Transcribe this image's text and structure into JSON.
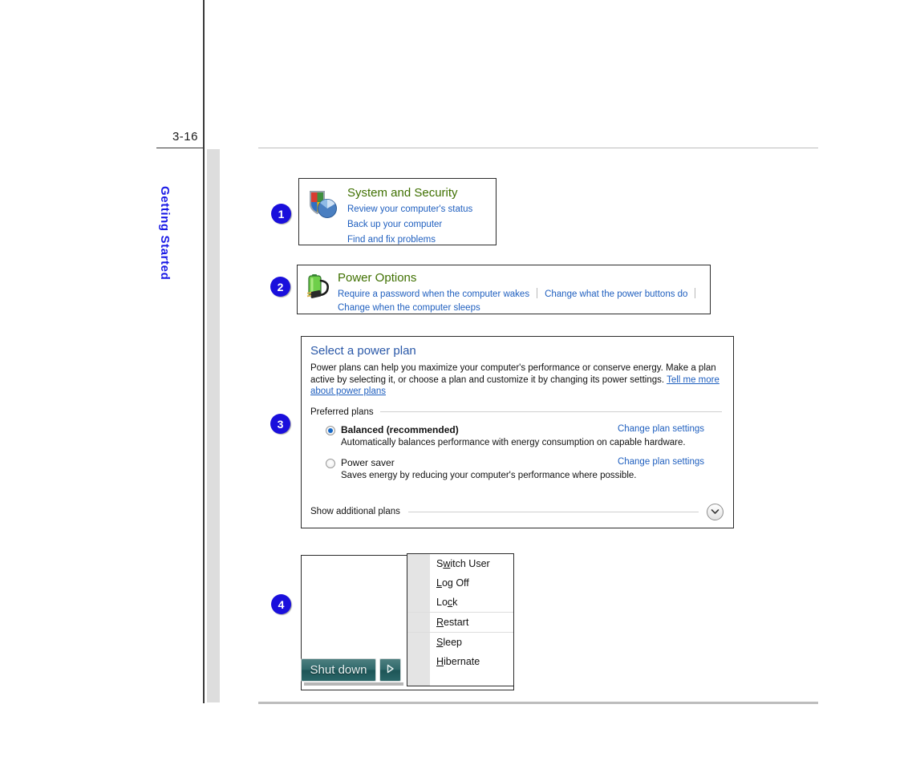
{
  "page": {
    "folio": "3-16",
    "side_tab_label": "Getting Started"
  },
  "colors": {
    "badge_blue": "#1a0fdc",
    "side_tab_blue": "#1a1ae6",
    "link_blue": "#1f5fbf",
    "heading_green": "#3f7000",
    "panel_title_blue": "#2a58a8",
    "shutdown_teal": "#30696b"
  },
  "steps": [
    {
      "number": "1"
    },
    {
      "number": "2"
    },
    {
      "number": "3"
    },
    {
      "number": "4"
    }
  ],
  "panel_system_security": {
    "icon": "shield-pie-icon",
    "heading": "System and Security",
    "links": [
      "Review your computer's status",
      "Back up your computer",
      "Find and fix problems"
    ]
  },
  "panel_power_options": {
    "icon": "battery-plug-icon",
    "heading": "Power Options",
    "links_row1": [
      "Require a password when the computer wakes",
      "Change what the power buttons do"
    ],
    "links_row2": [
      "Change when the computer sleeps"
    ]
  },
  "panel_select_power_plan": {
    "title": "Select a power plan",
    "description_before_link": "Power plans can help you maximize your computer's performance or conserve energy. Make a plan active by selecting it, or choose a plan and customize it by changing its power settings. ",
    "description_link": "Tell me more about power plans",
    "section_label": "Preferred plans",
    "plans": [
      {
        "name": "Balanced (recommended)",
        "selected": true,
        "description": "Automatically balances performance with energy consumption on capable hardware.",
        "action": "Change plan settings"
      },
      {
        "name": "Power saver",
        "selected": false,
        "description": "Saves energy by reducing your computer's performance where possible.",
        "action": "Change plan settings"
      }
    ],
    "footer_label": "Show additional plans",
    "footer_icon": "chevron-down-icon"
  },
  "panel_shutdown": {
    "button_label": "Shut down",
    "arrow_icon": "triangle-right-icon",
    "menu_items": [
      {
        "label": "Switch User",
        "accel_index": 1,
        "divider_above": false
      },
      {
        "label": "Log Off",
        "accel_index": 0,
        "divider_above": false
      },
      {
        "label": "Lock",
        "accel_index": 2,
        "divider_above": false
      },
      {
        "label": "Restart",
        "accel_index": 0,
        "divider_above": true
      },
      {
        "label": "Sleep",
        "accel_index": 0,
        "divider_above": true
      },
      {
        "label": "Hibernate",
        "accel_index": 0,
        "divider_above": false
      }
    ]
  }
}
